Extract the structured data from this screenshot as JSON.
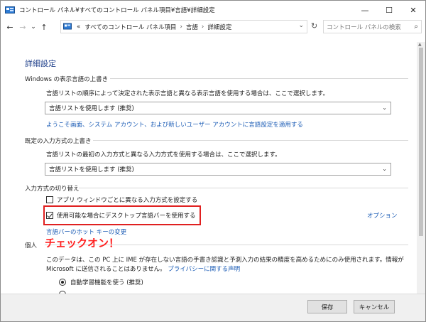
{
  "window": {
    "title": "コントロール パネル¥すべてのコントロール パネル項目¥言語¥詳細設定",
    "minimize_label": "—",
    "maximize_label": "☐",
    "close_label": "✕"
  },
  "nav": {
    "back_label": "←",
    "forward_label": "→",
    "history_label": "⌄",
    "up_label": "↑",
    "address": {
      "prefix": "«",
      "crumbs": [
        "すべてのコントロール パネル項目",
        "言語",
        "詳細設定"
      ],
      "separator": "›",
      "dropdown": "⌄"
    },
    "refresh_label": "↻",
    "search_placeholder": "コントロール パネルの検索",
    "search_icon_label": "⌕"
  },
  "page": {
    "heading": "詳細設定",
    "override_display": {
      "title": "Windows の表示言語の上書き",
      "description": "言語リストの順序によって決定された表示言語と異なる表示言語を使用する場合は、ここで選択します。",
      "select_value": "言語リストを使用します (推奨)",
      "link": "ようこそ画面、システム アカウント、および新しいユーザー アカウントに言語設定を適用する"
    },
    "override_input": {
      "title": "既定の入力方式の上書き",
      "description": "言語リストの最初の入力方式と異なる入力方式を使用する場合は、ここで選択します。",
      "select_value": "言語リストを使用します (推奨)"
    },
    "switch_input": {
      "title": "入力方式の切り替え",
      "checkbox1_label": "アプリ ウィンドウごとに異なる入力方式を設定する",
      "checkbox2_label": "使用可能な場合にデスクトップ言語バーを使用する",
      "checkbox2_checked": true,
      "options_link": "オプション",
      "hotkey_link": "言語バーのホット キーの変更"
    },
    "personal": {
      "title": "個人",
      "description_line1": "このデータは、この PC 上に IME が存在しない言語の手書き認識と予測入力の結果の精度を高めるためにのみ使用されます。情報が",
      "description_line2": "Microsoft に送信されることはありません。",
      "privacy_link": "プライバシーに関する声明",
      "radio1_label": "自動学習機能を使う (推奨)"
    },
    "annotation": "チェックオン！"
  },
  "footer": {
    "save_label": "保存",
    "cancel_label": "キャンセル"
  },
  "colors": {
    "heading": "#1e3f8a",
    "link": "#1a5bb5",
    "highlight": "#e02020",
    "annotation": "#ff2020"
  }
}
